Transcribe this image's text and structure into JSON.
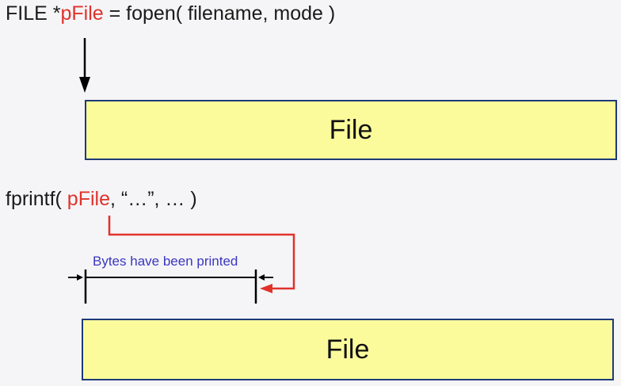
{
  "code1": {
    "prefix": "FILE *",
    "pointer": "pFile",
    "suffix": " = fopen( filename, mode )"
  },
  "code2": {
    "prefix": "fprintf( ",
    "pointer": "pFile",
    "suffix": ", “…”, … )"
  },
  "file_box_1": {
    "label": "File"
  },
  "file_box_2": {
    "label": "File"
  },
  "bytes_label": "Bytes have been printed",
  "colors": {
    "pointer": "#e0322b",
    "box_fill": "#fbfb9c",
    "box_border": "#1e3a78",
    "annotation": "#3a36c0"
  }
}
